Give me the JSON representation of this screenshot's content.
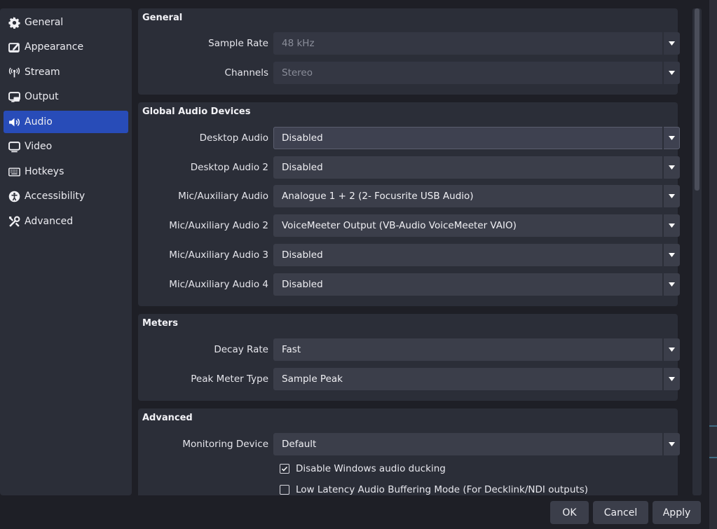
{
  "sidebar": {
    "items": [
      {
        "label": "General",
        "icon": "gear-icon"
      },
      {
        "label": "Appearance",
        "icon": "appearance-icon"
      },
      {
        "label": "Stream",
        "icon": "stream-icon"
      },
      {
        "label": "Output",
        "icon": "output-icon"
      },
      {
        "label": "Audio",
        "icon": "speaker-icon",
        "active": true
      },
      {
        "label": "Video",
        "icon": "monitor-icon"
      },
      {
        "label": "Hotkeys",
        "icon": "keyboard-icon"
      },
      {
        "label": "Accessibility",
        "icon": "accessibility-icon"
      },
      {
        "label": "Advanced",
        "icon": "tools-icon"
      }
    ]
  },
  "general": {
    "title": "General",
    "sample_rate_label": "Sample Rate",
    "sample_rate_value": "48 kHz",
    "channels_label": "Channels",
    "channels_value": "Stereo"
  },
  "devices": {
    "title": "Global Audio Devices",
    "desktop_audio_label": "Desktop Audio",
    "desktop_audio_value": "Disabled",
    "desktop_audio_2_label": "Desktop Audio 2",
    "desktop_audio_2_value": "Disabled",
    "mic_label": "Mic/Auxiliary Audio",
    "mic_value": "Analogue 1 + 2 (2- Focusrite USB Audio)",
    "mic_2_label": "Mic/Auxiliary Audio 2",
    "mic_2_value": "VoiceMeeter Output (VB-Audio VoiceMeeter VAIO)",
    "mic_3_label": "Mic/Auxiliary Audio 3",
    "mic_3_value": "Disabled",
    "mic_4_label": "Mic/Auxiliary Audio 4",
    "mic_4_value": "Disabled"
  },
  "meters": {
    "title": "Meters",
    "decay_rate_label": "Decay Rate",
    "decay_rate_value": "Fast",
    "peak_meter_label": "Peak Meter Type",
    "peak_meter_value": "Sample Peak"
  },
  "advanced": {
    "title": "Advanced",
    "monitoring_label": "Monitoring Device",
    "monitoring_value": "Default",
    "ducking_label": "Disable Windows audio ducking",
    "ducking_checked": true,
    "low_latency_label": "Low Latency Audio Buffering Mode (For Decklink/NDI outputs)",
    "low_latency_checked": false
  },
  "buttons": {
    "ok": "OK",
    "cancel": "Cancel",
    "apply": "Apply"
  },
  "colors": {
    "accent": "#284cb8",
    "panel": "#2b2e38",
    "background": "#1e1f26"
  }
}
